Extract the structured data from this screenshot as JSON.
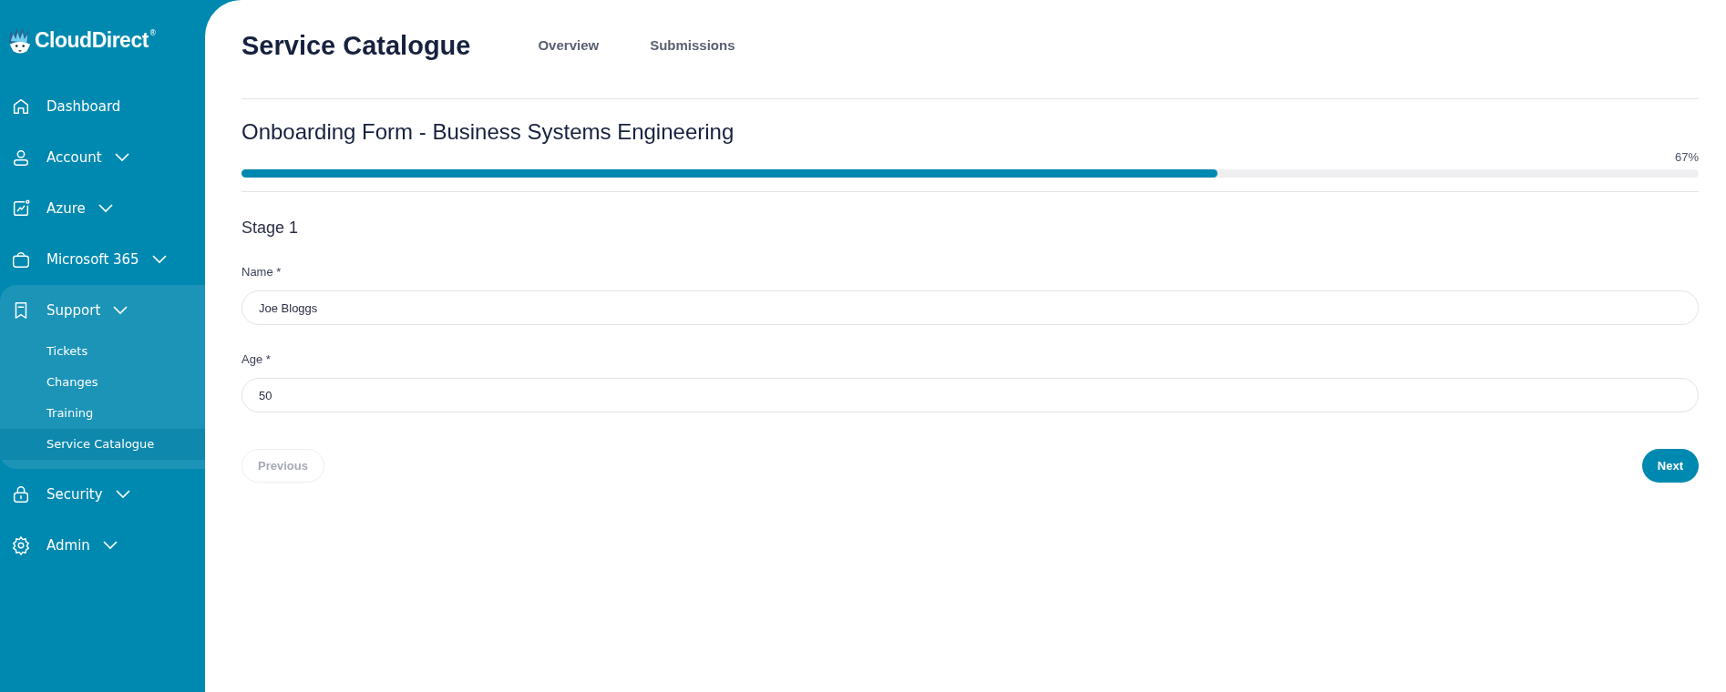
{
  "logo": {
    "text": "CloudDirect",
    "mark": "®"
  },
  "sidebar": {
    "items": [
      {
        "kind": "link",
        "label": "Dashboard",
        "expanded": false
      },
      {
        "kind": "group",
        "label": "Account",
        "expanded": false
      },
      {
        "kind": "group",
        "label": "Azure",
        "expanded": false
      },
      {
        "kind": "group",
        "label": "Microsoft 365",
        "expanded": false
      },
      {
        "kind": "group",
        "label": "Support",
        "expanded": true,
        "children": [
          {
            "label": "Tickets",
            "selected": false
          },
          {
            "label": "Changes",
            "selected": false
          },
          {
            "label": "Training",
            "selected": false
          },
          {
            "label": "Service Catalogue",
            "selected": true
          }
        ]
      },
      {
        "kind": "group",
        "label": "Security",
        "expanded": false
      },
      {
        "kind": "group",
        "label": "Admin",
        "expanded": false
      }
    ]
  },
  "header": {
    "title": "Service Catalogue",
    "tabs": [
      {
        "label": "Overview",
        "selected": false
      },
      {
        "label": "Submissions",
        "selected": false
      }
    ]
  },
  "form": {
    "title": "Onboarding Form - Business Systems Engineering",
    "progress": {
      "level": 0.67,
      "reading": "67%"
    },
    "stage": "Stage 1",
    "fields": [
      {
        "label": "Name *",
        "value": "Joe Bloggs"
      },
      {
        "label": "Age *",
        "value": "50"
      }
    ],
    "buttons": [
      {
        "label": "Previous",
        "kind": "back",
        "disabled": true
      },
      {
        "label": "Next",
        "kind": "forward",
        "disabled": false
      }
    ]
  }
}
